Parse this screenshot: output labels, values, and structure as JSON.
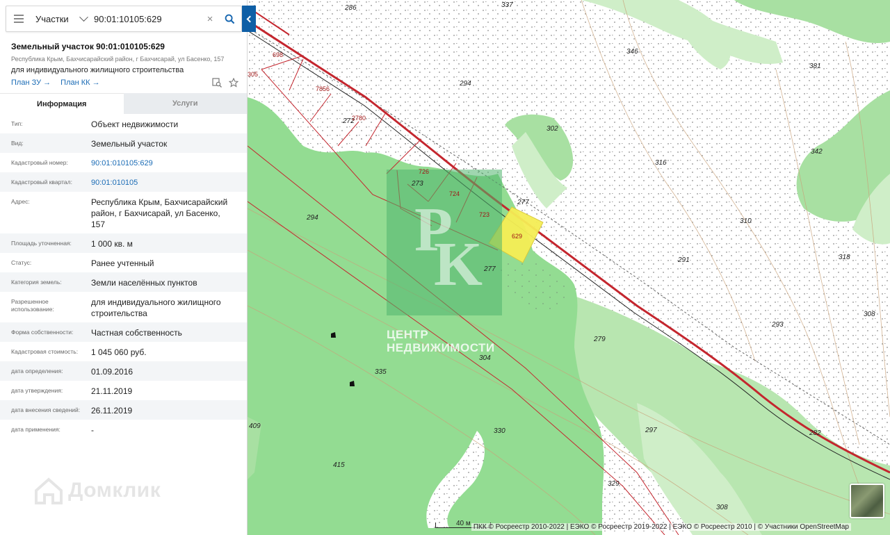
{
  "search": {
    "category": "Участки",
    "query": "90:01:10105:629"
  },
  "object": {
    "title": "Земельный участок 90:01:010105:629",
    "address_short": "Республика Крым, Бахчисарайский район, г Бахчисарай, ул Басенко, 157",
    "purpose": "для индивидуального жилищного строительства",
    "links": [
      "План ЗУ",
      "План КК"
    ]
  },
  "tabs": [
    "Информация",
    "Услуги"
  ],
  "info": [
    {
      "key": "Тип:",
      "value": "Объект недвижимости"
    },
    {
      "key": "Вид:",
      "value": "Земельный участок"
    },
    {
      "key": "Кадастровый номер:",
      "value": "90:01:010105:629"
    },
    {
      "key": "Кадастровый квартал:",
      "value": "90:01:010105"
    },
    {
      "key": "Адрес:",
      "value": "Республика Крым, Бахчисарайский район, г Бахчисарай, ул Басенко, 157"
    },
    {
      "key": "Площадь уточненная:",
      "value": "1 000 кв. м"
    },
    {
      "key": "Статус:",
      "value": "Ранее учтенный"
    },
    {
      "key": "Категория земель:",
      "value": "Земли населённых пунктов"
    },
    {
      "key": "Разрешенное использование:",
      "value": "для индивидуального жилищного строительства"
    },
    {
      "key": "Форма собственности:",
      "value": "Частная собственность"
    },
    {
      "key": "Кадастровая стоимость:",
      "value": "1 045 060 руб."
    },
    {
      "key": "дата определения:",
      "value": "01.09.2016"
    },
    {
      "key": "дата утверждения:",
      "value": "21.11.2019"
    },
    {
      "key": "дата внесения сведений:",
      "value": "26.11.2019"
    },
    {
      "key": "дата применения:",
      "value": "-"
    }
  ],
  "brand": "Домклик",
  "map": {
    "watermark": [
      "ЦЕНТР",
      "НЕДВИЖИМОСТИ"
    ],
    "scale": "40 м",
    "attribution": "ПКК © Росреестр 2010-2022 | ЕЭКО © Росреестр 2019-2022 | ЕЭКО © Росреестр 2010 | © Участники OpenStreetMap",
    "elevations": [
      "286",
      "337",
      "346",
      "381",
      "294",
      "302",
      "342",
      "316",
      "294",
      "277",
      "291",
      "310",
      "318",
      "277",
      "279",
      "293",
      "308",
      "304",
      "335",
      "297",
      "282",
      "330",
      "329",
      "415",
      "308",
      "409",
      "272",
      "273"
    ],
    "parcels": [
      "698",
      "7856",
      "2780",
      "726",
      "724",
      "723",
      "629",
      "305"
    ],
    "colors": {
      "forest": "#93dc92",
      "highlight": "#f5ee55",
      "road": "#c4262e"
    }
  }
}
